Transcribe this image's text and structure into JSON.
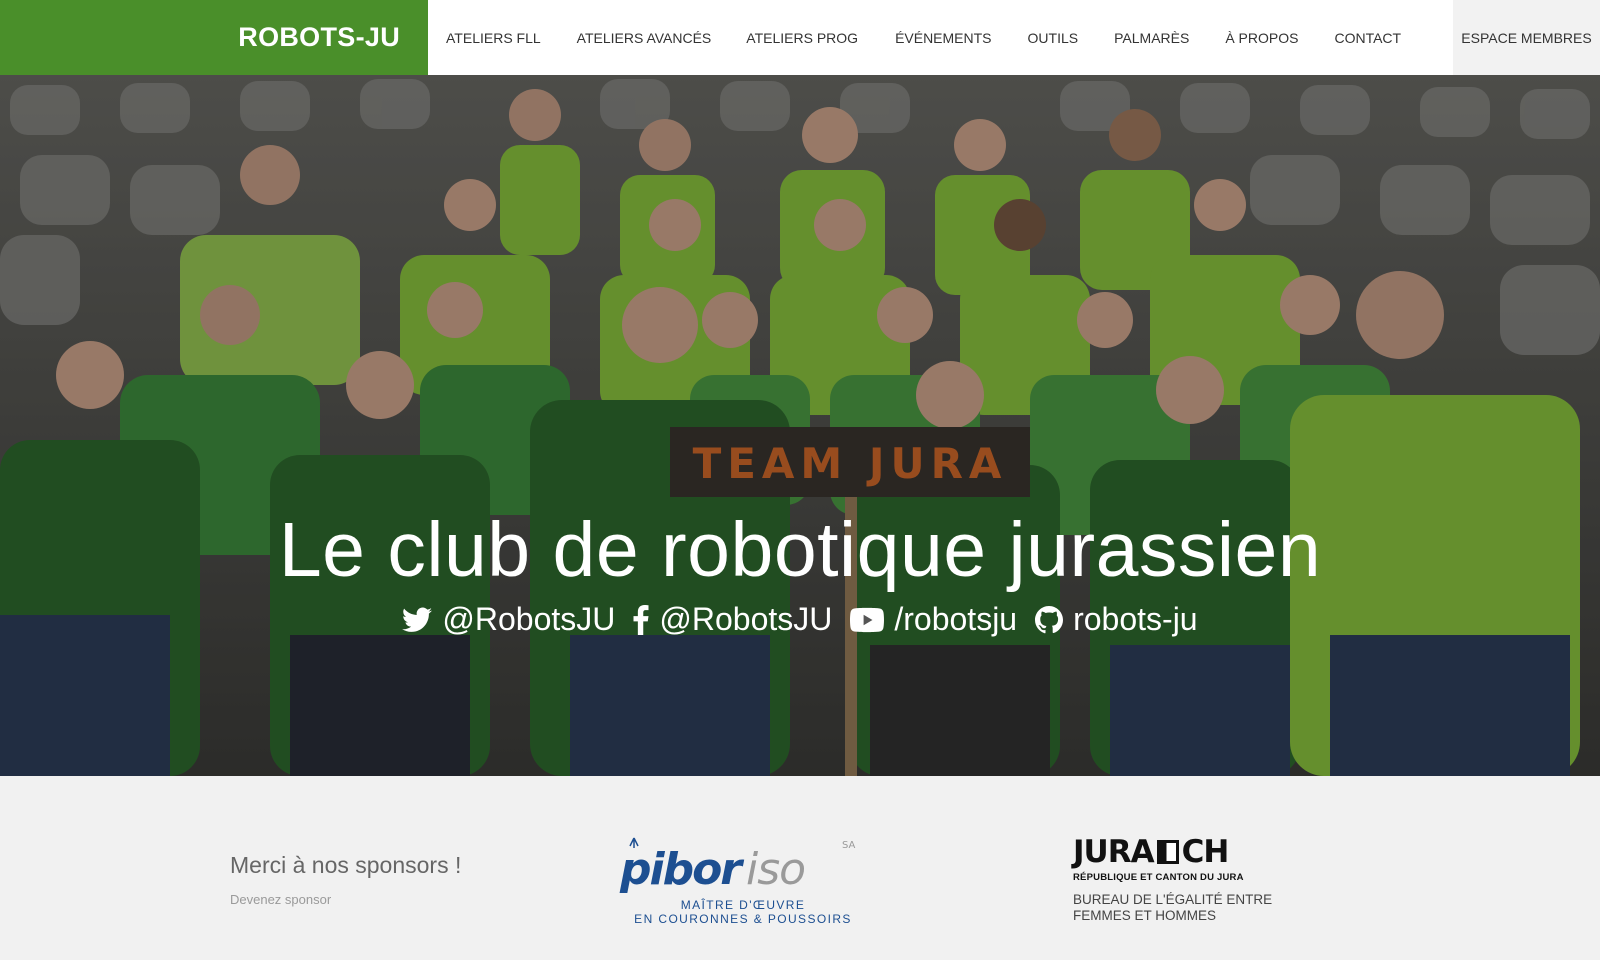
{
  "header": {
    "brand": "ROBOTS-JU",
    "nav": [
      {
        "label": "ATELIERS FLL"
      },
      {
        "label": "ATELIERS AVANCÉS"
      },
      {
        "label": "ATELIERS PROG"
      },
      {
        "label": "ÉVÉNEMENTS"
      },
      {
        "label": "OUTILS"
      },
      {
        "label": "PALMARÈS"
      },
      {
        "label": "À PROPOS"
      },
      {
        "label": "CONTACT"
      }
    ],
    "members": "ESPACE MEMBRES"
  },
  "hero": {
    "title": "Le club de robotique jurassien",
    "sign_text": "TEAM JURA",
    "socials": [
      {
        "icon": "twitter-icon",
        "text": "@RobotsJU"
      },
      {
        "icon": "facebook-icon",
        "text": "@RobotsJU"
      },
      {
        "icon": "youtube-icon",
        "text": "/robotsju"
      },
      {
        "icon": "github-icon",
        "text": "robots-ju"
      }
    ]
  },
  "sponsors": {
    "thanks": "Merci à nos sponsors !",
    "become": "Devenez sponsor",
    "pibor": {
      "name_part1": "pibor",
      "name_part2": "iso",
      "suffix": "SA",
      "line1": "MAÎTRE D'ŒUVRE",
      "line2": "EN COURONNES & POUSSOIRS"
    },
    "jura": {
      "name_left": "JURA",
      "name_right": "CH",
      "subtitle": "RÉPUBLIQUE ET CANTON DU JURA",
      "office": "BUREAU DE L'ÉGALITÉ ENTRE FEMMES ET HOMMES"
    }
  },
  "colors": {
    "brand_green": "#4a8f2a",
    "shirt_light": "#8cc63f",
    "shirt_dark": "#2f6b2f",
    "pibor_blue": "#1d4f91",
    "pibor_grey": "#9a9a9a"
  }
}
